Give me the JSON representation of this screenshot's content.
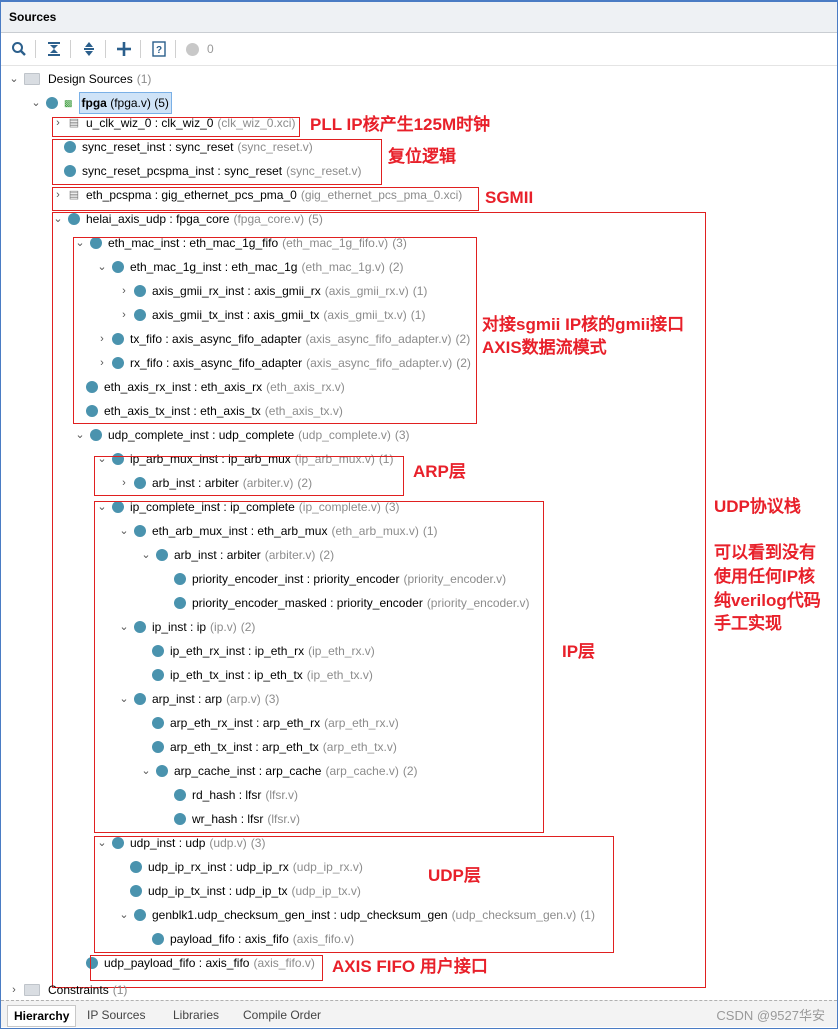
{
  "panel": {
    "title": "Sources"
  },
  "toolbar": {
    "warning_count": "0"
  },
  "tree": {
    "design_sources": {
      "label": "Design Sources",
      "count": "(1)"
    },
    "constraints": {
      "label": "Constraints",
      "count": "(1)"
    },
    "nodes": [
      {
        "inst": "fpga",
        "mod": "",
        "file": "(fpga.v)",
        "count": "(5)"
      },
      {
        "inst": "u_clk_wiz_0",
        "mod": "clk_wiz_0",
        "file": "(clk_wiz_0.xci)",
        "count": ""
      },
      {
        "inst": "sync_reset_inst",
        "mod": "sync_reset",
        "file": "(sync_reset.v)",
        "count": ""
      },
      {
        "inst": "sync_reset_pcspma_inst",
        "mod": "sync_reset",
        "file": "(sync_reset.v)",
        "count": ""
      },
      {
        "inst": "eth_pcspma",
        "mod": "gig_ethernet_pcs_pma_0",
        "file": "(gig_ethernet_pcs_pma_0.xci)",
        "count": ""
      },
      {
        "inst": "helai_axis_udp",
        "mod": "fpga_core",
        "file": "(fpga_core.v)",
        "count": "(5)"
      },
      {
        "inst": "eth_mac_inst",
        "mod": "eth_mac_1g_fifo",
        "file": "(eth_mac_1g_fifo.v)",
        "count": "(3)"
      },
      {
        "inst": "eth_mac_1g_inst",
        "mod": "eth_mac_1g",
        "file": "(eth_mac_1g.v)",
        "count": "(2)"
      },
      {
        "inst": "axis_gmii_rx_inst",
        "mod": "axis_gmii_rx",
        "file": "(axis_gmii_rx.v)",
        "count": "(1)"
      },
      {
        "inst": "axis_gmii_tx_inst",
        "mod": "axis_gmii_tx",
        "file": "(axis_gmii_tx.v)",
        "count": "(1)"
      },
      {
        "inst": "tx_fifo",
        "mod": "axis_async_fifo_adapter",
        "file": "(axis_async_fifo_adapter.v)",
        "count": "(2)"
      },
      {
        "inst": "rx_fifo",
        "mod": "axis_async_fifo_adapter",
        "file": "(axis_async_fifo_adapter.v)",
        "count": "(2)"
      },
      {
        "inst": "eth_axis_rx_inst",
        "mod": "eth_axis_rx",
        "file": "(eth_axis_rx.v)",
        "count": ""
      },
      {
        "inst": "eth_axis_tx_inst",
        "mod": "eth_axis_tx",
        "file": "(eth_axis_tx.v)",
        "count": ""
      },
      {
        "inst": "udp_complete_inst",
        "mod": "udp_complete",
        "file": "(udp_complete.v)",
        "count": "(3)"
      },
      {
        "inst": "ip_arb_mux_inst",
        "mod": "ip_arb_mux",
        "file": "(ip_arb_mux.v)",
        "count": "(1)"
      },
      {
        "inst": "arb_inst",
        "mod": "arbiter",
        "file": "(arbiter.v)",
        "count": "(2)"
      },
      {
        "inst": "ip_complete_inst",
        "mod": "ip_complete",
        "file": "(ip_complete.v)",
        "count": "(3)"
      },
      {
        "inst": "eth_arb_mux_inst",
        "mod": "eth_arb_mux",
        "file": "(eth_arb_mux.v)",
        "count": "(1)"
      },
      {
        "inst": "arb_inst",
        "mod": "arbiter",
        "file": "(arbiter.v)",
        "count": "(2)"
      },
      {
        "inst": "priority_encoder_inst",
        "mod": "priority_encoder",
        "file": "(priority_encoder.v)",
        "count": ""
      },
      {
        "inst": "priority_encoder_masked",
        "mod": "priority_encoder",
        "file": "(priority_encoder.v)",
        "count": ""
      },
      {
        "inst": "ip_inst",
        "mod": "ip",
        "file": "(ip.v)",
        "count": "(2)"
      },
      {
        "inst": "ip_eth_rx_inst",
        "mod": "ip_eth_rx",
        "file": "(ip_eth_rx.v)",
        "count": ""
      },
      {
        "inst": "ip_eth_tx_inst",
        "mod": "ip_eth_tx",
        "file": "(ip_eth_tx.v)",
        "count": ""
      },
      {
        "inst": "arp_inst",
        "mod": "arp",
        "file": "(arp.v)",
        "count": "(3)"
      },
      {
        "inst": "arp_eth_rx_inst",
        "mod": "arp_eth_rx",
        "file": "(arp_eth_rx.v)",
        "count": ""
      },
      {
        "inst": "arp_eth_tx_inst",
        "mod": "arp_eth_tx",
        "file": "(arp_eth_tx.v)",
        "count": ""
      },
      {
        "inst": "arp_cache_inst",
        "mod": "arp_cache",
        "file": "(arp_cache.v)",
        "count": "(2)"
      },
      {
        "inst": "rd_hash",
        "mod": "lfsr",
        "file": "(lfsr.v)",
        "count": ""
      },
      {
        "inst": "wr_hash",
        "mod": "lfsr",
        "file": "(lfsr.v)",
        "count": ""
      },
      {
        "inst": "udp_inst",
        "mod": "udp",
        "file": "(udp.v)",
        "count": "(3)"
      },
      {
        "inst": "udp_ip_rx_inst",
        "mod": "udp_ip_rx",
        "file": "(udp_ip_rx.v)",
        "count": ""
      },
      {
        "inst": "udp_ip_tx_inst",
        "mod": "udp_ip_tx",
        "file": "(udp_ip_tx.v)",
        "count": ""
      },
      {
        "inst": "genblk1.udp_checksum_gen_inst",
        "mod": "udp_checksum_gen",
        "file": "(udp_checksum_gen.v)",
        "count": "(1)"
      },
      {
        "inst": "payload_fifo",
        "mod": "axis_fifo",
        "file": "(axis_fifo.v)",
        "count": ""
      },
      {
        "inst": "udp_payload_fifo",
        "mod": "axis_fifo",
        "file": "(axis_fifo.v)",
        "count": ""
      }
    ]
  },
  "annotations": {
    "pll": "PLL IP核产生125M时钟",
    "reset": "复位逻辑",
    "sgmii": "SGMII",
    "mac_1": "对接sgmii IP核的gmii接口",
    "mac_2": "AXIS数据流模式",
    "arp": "ARP层",
    "udp_stack": "UDP协议栈",
    "note_1": "可以看到没有",
    "note_2": "使用任何IP核",
    "note_3": "纯verilog代码",
    "note_4": "手工实现",
    "ip": "IP层",
    "udp": "UDP层",
    "fifo": "AXIS FIFO 用户接口"
  },
  "tabs": [
    "Hierarchy",
    "IP Sources",
    "Libraries",
    "Compile Order"
  ],
  "watermark": "CSDN @9527华安"
}
